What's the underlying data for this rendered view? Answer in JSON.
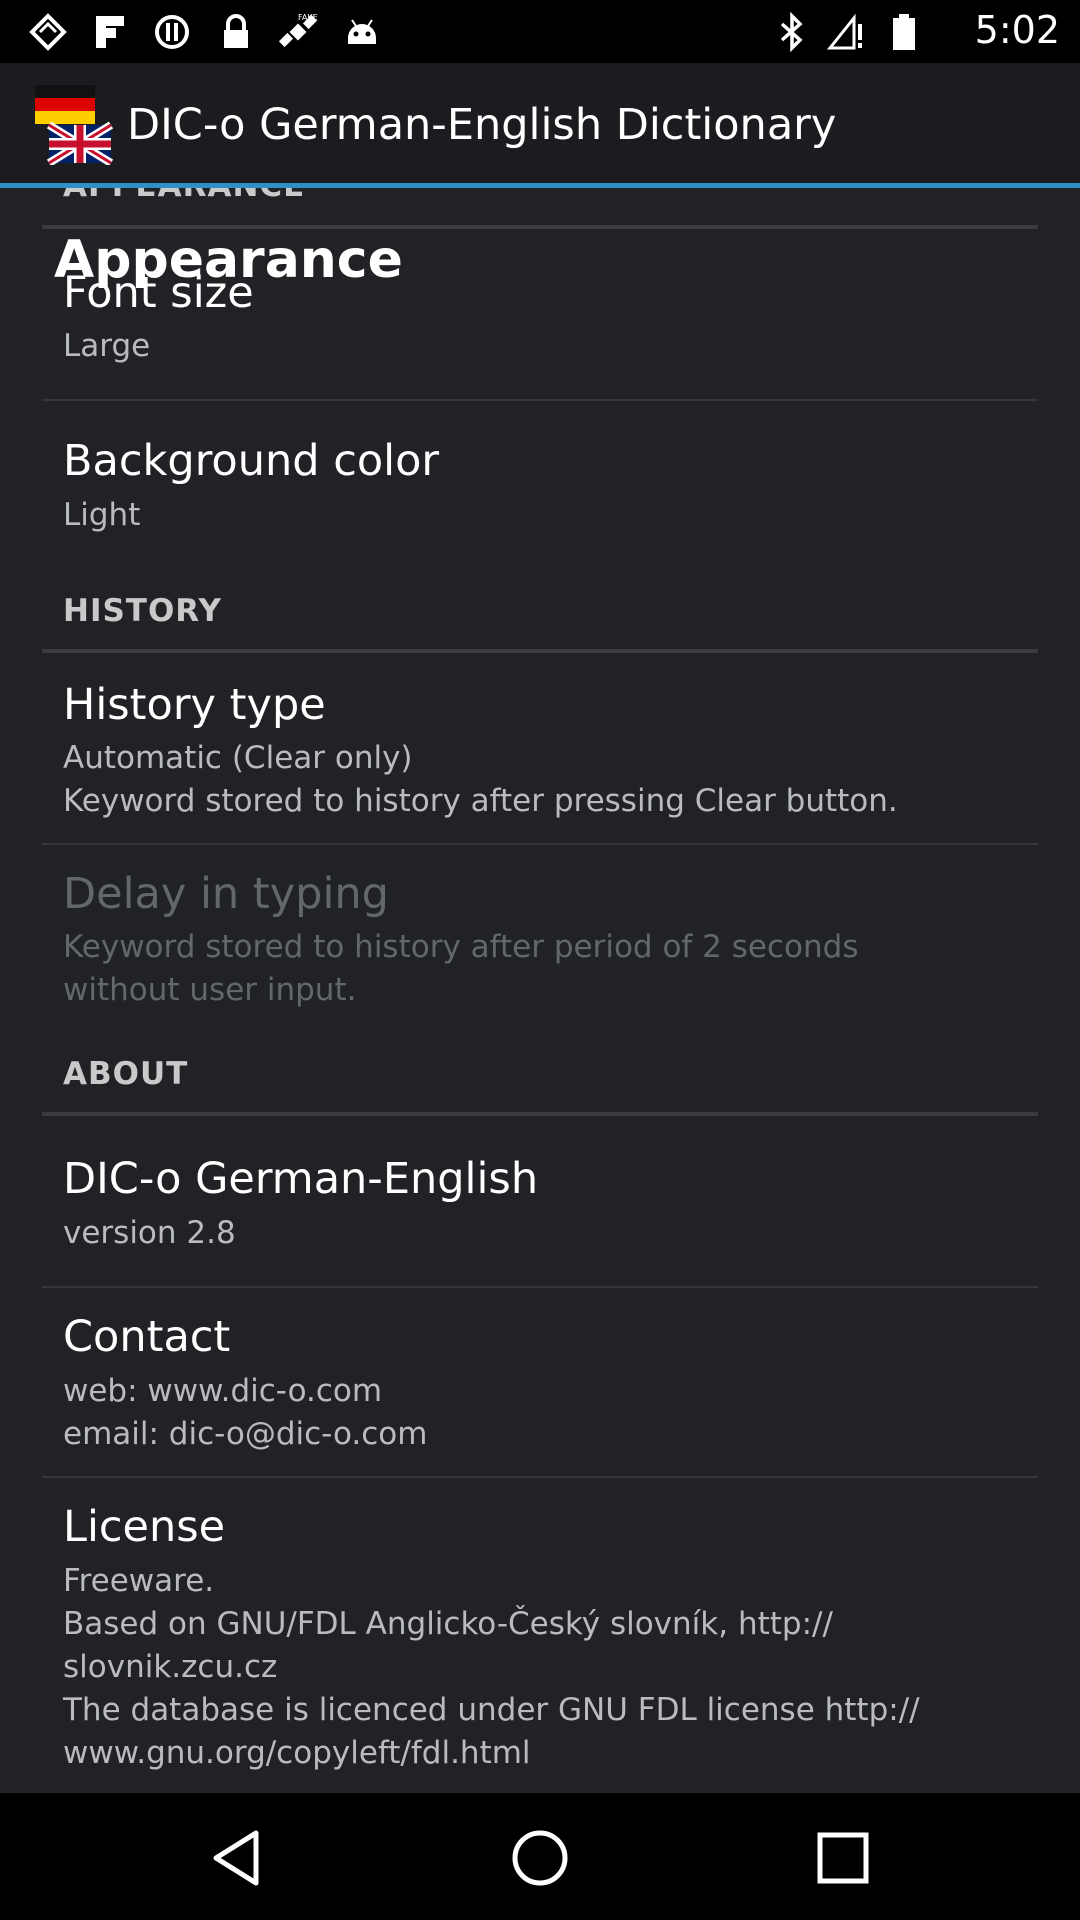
{
  "status_bar": {
    "time": "5:02",
    "left_icons": [
      "photos-icon",
      "flipboard-icon",
      "alert-icon",
      "lock-icon",
      "satellite-icon",
      "android-icon"
    ],
    "right_icons": [
      "bluetooth-icon",
      "no-signal-icon",
      "battery-icon"
    ]
  },
  "app_bar": {
    "title": "DIC-o German-English Dictionary",
    "icon": "german-english-flags-icon"
  },
  "overlay_title": "Appearance",
  "sections": {
    "appearance": {
      "header": "APPEARANCE",
      "font_size": {
        "title": "Font size",
        "summary": "Large"
      },
      "background_color": {
        "title": "Background color",
        "summary": "Light"
      }
    },
    "history": {
      "header": "HISTORY",
      "history_type": {
        "title": "History type",
        "summary": "Automatic (Clear only)\nKeyword stored to history after pressing Clear button."
      },
      "delay_in_typing": {
        "title": "Delay in typing",
        "summary": "Keyword stored to history after period of 2 seconds\nwithout user input."
      }
    },
    "about": {
      "header": "ABOUT",
      "app": {
        "title": "DIC-o German-English",
        "summary": "version 2.8"
      },
      "contact": {
        "title": "Contact",
        "summary": "web: www.dic-o.com\nemail: dic-o@dic-o.com"
      },
      "license": {
        "title": "License",
        "summary": "Freeware.\nBased on GNU/FDL Anglicko-Český slovník, http://\nslovnik.zcu.cz\nThe database is licenced under GNU FDL license http://\nwww.gnu.org/copyleft/fdl.html"
      }
    }
  },
  "colors": {
    "accent": "#2f8fc9",
    "background": "#202226",
    "action_bar": "#1a1c1f"
  }
}
